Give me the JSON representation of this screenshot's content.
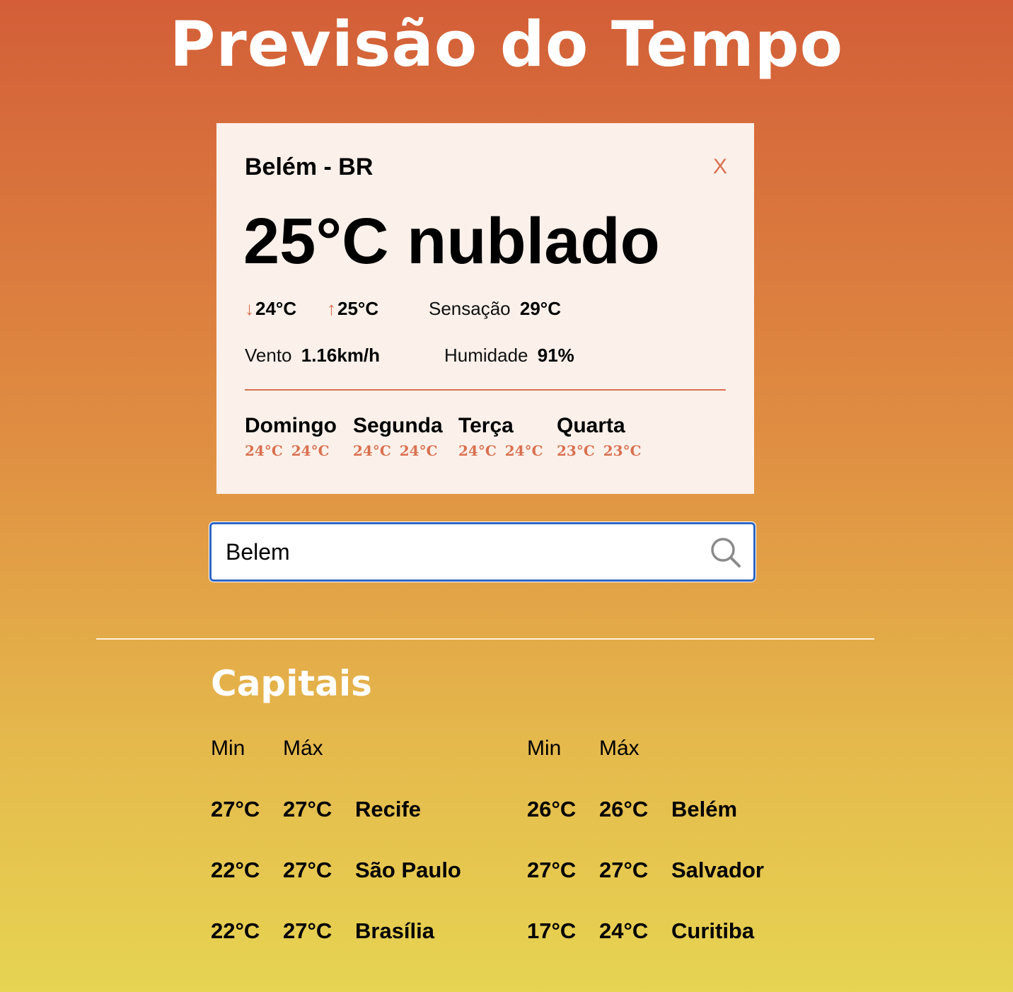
{
  "header": {
    "title": "Previsão do Tempo"
  },
  "weather_card": {
    "city": "Belém - BR",
    "close_label": "X",
    "current": "25°C nublado",
    "min_temp": "24°C",
    "max_temp": "25°C",
    "feels_label": "Sensação",
    "feels_value": "29°C",
    "wind_label": "Vento",
    "wind_value": "1.16km/h",
    "humidity_label": "Humidade",
    "humidity_value": "91%",
    "forecast": [
      {
        "day": "Domingo",
        "min": "24°C",
        "max": "24°C"
      },
      {
        "day": "Segunda",
        "min": "24°C",
        "max": "24°C"
      },
      {
        "day": "Terça",
        "min": "24°C",
        "max": "24°C"
      },
      {
        "day": "Quarta",
        "min": "23°C",
        "max": "23°C"
      }
    ]
  },
  "search": {
    "value": "Belem",
    "icon": "search-icon"
  },
  "capitals": {
    "title": "Capitais",
    "min_header": "Min",
    "max_header": "Máx",
    "left": [
      {
        "min": "27°C",
        "max": "27°C",
        "city": "Recife"
      },
      {
        "min": "22°C",
        "max": "27°C",
        "city": "São Paulo"
      },
      {
        "min": "22°C",
        "max": "27°C",
        "city": "Brasília"
      }
    ],
    "right": [
      {
        "min": "26°C",
        "max": "26°C",
        "city": "Belém"
      },
      {
        "min": "27°C",
        "max": "27°C",
        "city": "Salvador"
      },
      {
        "min": "17°C",
        "max": "24°C",
        "city": "Curitiba"
      }
    ]
  },
  "colors": {
    "accent": "#d9704f",
    "card_bg": "#fbf0ea",
    "focus_border": "#2f66c4"
  }
}
